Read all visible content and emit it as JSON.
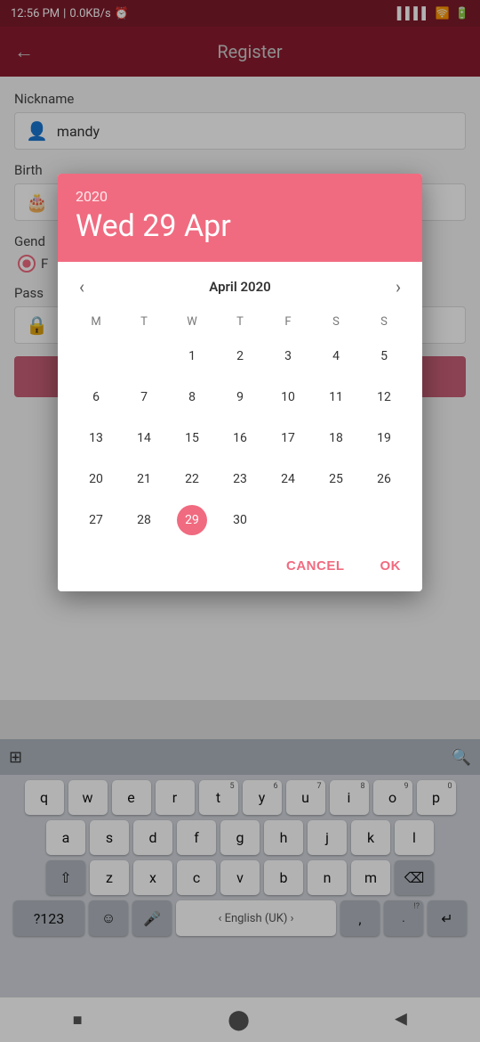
{
  "statusBar": {
    "time": "12:56 PM",
    "data": "0.0KB/s",
    "alarmIcon": "⏰"
  },
  "header": {
    "title": "Register",
    "backIcon": "←"
  },
  "form": {
    "nicknameLabel": "Nickname",
    "nicknameValue": "mandy",
    "birthLabel": "Birth",
    "genderLabel": "Gend",
    "passwordLabel": "Pass"
  },
  "dialog": {
    "year": "2020",
    "dateDisplay": "Wed 29 Apr",
    "monthLabel": "April 2020",
    "selectedDay": 29,
    "weekdays": [
      "M",
      "T",
      "W",
      "T",
      "F",
      "S",
      "S"
    ],
    "weeks": [
      [
        null,
        null,
        1,
        2,
        3,
        4,
        5
      ],
      [
        6,
        7,
        8,
        9,
        10,
        11,
        12
      ],
      [
        13,
        14,
        15,
        16,
        17,
        18,
        19
      ],
      [
        20,
        21,
        22,
        23,
        24,
        25,
        26
      ],
      [
        27,
        28,
        29,
        30,
        null,
        null,
        null
      ]
    ],
    "cancelLabel": "CANCEL",
    "okLabel": "OK"
  },
  "keyboard": {
    "row1": [
      "q",
      "w",
      "e",
      "r",
      "t",
      "y",
      "u",
      "i",
      "o",
      "p"
    ],
    "row2": [
      "a",
      "s",
      "d",
      "f",
      "g",
      "h",
      "j",
      "k",
      "l"
    ],
    "row3": [
      "z",
      "x",
      "c",
      "v",
      "b",
      "n",
      "m"
    ],
    "spaceLabel": "English (UK)",
    "numLabel": "?123",
    "emojiLabel": "☺",
    "micLabel": "🎤",
    "returnLabel": "↵",
    "deleteLabel": "⌫",
    "shiftLabel": "⇧",
    "commaLabel": ","
  },
  "navBar": {
    "squareIcon": "■",
    "circleIcon": "●",
    "triangleIcon": "▲"
  },
  "colors": {
    "headerBg": "#8b1a2e",
    "dialogHeaderBg": "#f06b80",
    "accentColor": "#f06b80",
    "selectedDayBg": "#f06b80"
  }
}
